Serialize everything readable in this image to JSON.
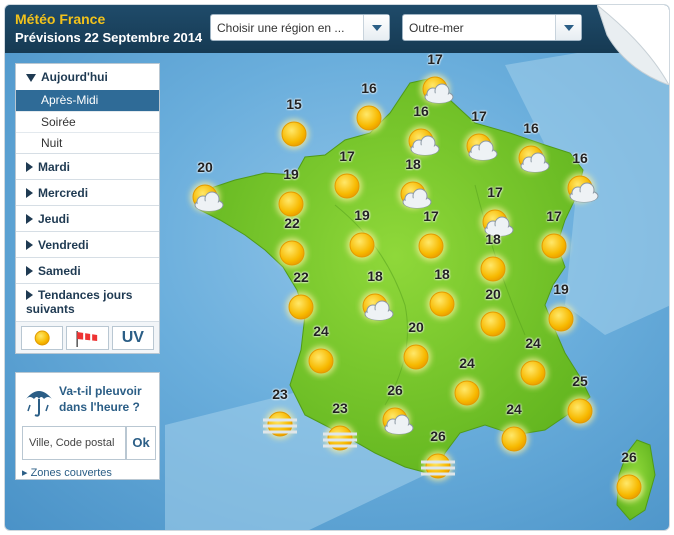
{
  "header": {
    "brand": "Météo France",
    "subtitle": "Prévisions 22 Septembre 2014",
    "region_select": "Choisir une région en ...",
    "outremer_select": "Outre-mer"
  },
  "menu": {
    "today": "Aujourd'hui",
    "today_periods": [
      "Après-Midi",
      "Soirée",
      "Nuit"
    ],
    "days": [
      "Mardi",
      "Mercredi",
      "Jeudi",
      "Vendredi",
      "Samedi"
    ],
    "trends": "Tendances jours suivants",
    "uv_label": "UV",
    "icons": [
      "sun-icon",
      "windsock-icon"
    ]
  },
  "rain": {
    "title": "Va-t-il pleuvoir dans l'heure ?",
    "placeholder": "Ville, Code postal",
    "ok": "Ok",
    "zones": "Zones couvertes"
  },
  "colors": {
    "header": "#1f4b6a",
    "brand": "#f2c21b",
    "sea": "#6aaedc",
    "land": "#7fcd2d",
    "active": "#2f6b97"
  },
  "forecasts": [
    {
      "t": "17",
      "icon": "partly-cloudy"
    },
    {
      "t": "16",
      "icon": "sun"
    },
    {
      "t": "15",
      "icon": "sun"
    },
    {
      "t": "16",
      "icon": "partly-cloudy"
    },
    {
      "t": "17",
      "icon": "partly-cloudy"
    },
    {
      "t": "16",
      "icon": "partly-cloudy"
    },
    {
      "t": "16",
      "icon": "partly-cloudy"
    },
    {
      "t": "20",
      "icon": "partly-cloudy"
    },
    {
      "t": "19",
      "icon": "sun"
    },
    {
      "t": "17",
      "icon": "sun"
    },
    {
      "t": "18",
      "icon": "partly-cloudy"
    },
    {
      "t": "17",
      "icon": "partly-cloudy"
    },
    {
      "t": "22",
      "icon": "sun"
    },
    {
      "t": "19",
      "icon": "sun"
    },
    {
      "t": "17",
      "icon": "sun"
    },
    {
      "t": "18",
      "icon": "sun"
    },
    {
      "t": "17",
      "icon": "sun"
    },
    {
      "t": "22",
      "icon": "sun"
    },
    {
      "t": "18",
      "icon": "partly-cloudy"
    },
    {
      "t": "18",
      "icon": "sun"
    },
    {
      "t": "20",
      "icon": "sun"
    },
    {
      "t": "19",
      "icon": "sun"
    },
    {
      "t": "24",
      "icon": "sun"
    },
    {
      "t": "20",
      "icon": "sun"
    },
    {
      "t": "24",
      "icon": "sun"
    },
    {
      "t": "24",
      "icon": "sun"
    },
    {
      "t": "23",
      "icon": "haze"
    },
    {
      "t": "26",
      "icon": "partly-cloudy"
    },
    {
      "t": "25",
      "icon": "sun"
    },
    {
      "t": "23",
      "icon": "haze"
    },
    {
      "t": "24",
      "icon": "sun"
    },
    {
      "t": "26",
      "icon": "haze"
    },
    {
      "t": "26",
      "icon": "sun"
    }
  ]
}
